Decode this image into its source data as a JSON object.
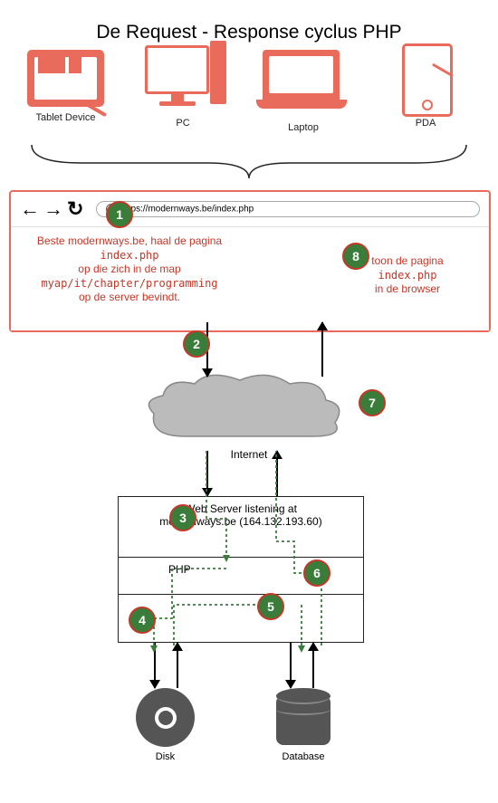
{
  "title": "De Request - Response cyclus PHP",
  "devices": {
    "tablet": "Tablet Device",
    "pc": "PC",
    "laptop": "Laptop",
    "pda": "PDA"
  },
  "browser": {
    "url": "https://modernways.be/index.php",
    "request_msg_l1": "Beste modernways.be, haal de pagina",
    "request_msg_l2": "index.php",
    "request_msg_l3": "op die zich in de map",
    "request_msg_l4": "myap/it/chapter/programming",
    "request_msg_l5": "op de server bevindt.",
    "response_msg_l1": "toon de pagina",
    "response_msg_l2": "index.php",
    "response_msg_l3": "in de browser"
  },
  "cloud": {
    "label": "Internet"
  },
  "server": {
    "web_l1": "Web Server listening at",
    "web_l2": "modernways.be (164.132.193.60)",
    "php": "PHP"
  },
  "storage": {
    "disk": "Disk",
    "db": "Database"
  },
  "steps": {
    "s1": "1",
    "s2": "2",
    "s3": "3",
    "s4": "4",
    "s5": "5",
    "s6": "6",
    "s7": "7",
    "s8": "8"
  }
}
